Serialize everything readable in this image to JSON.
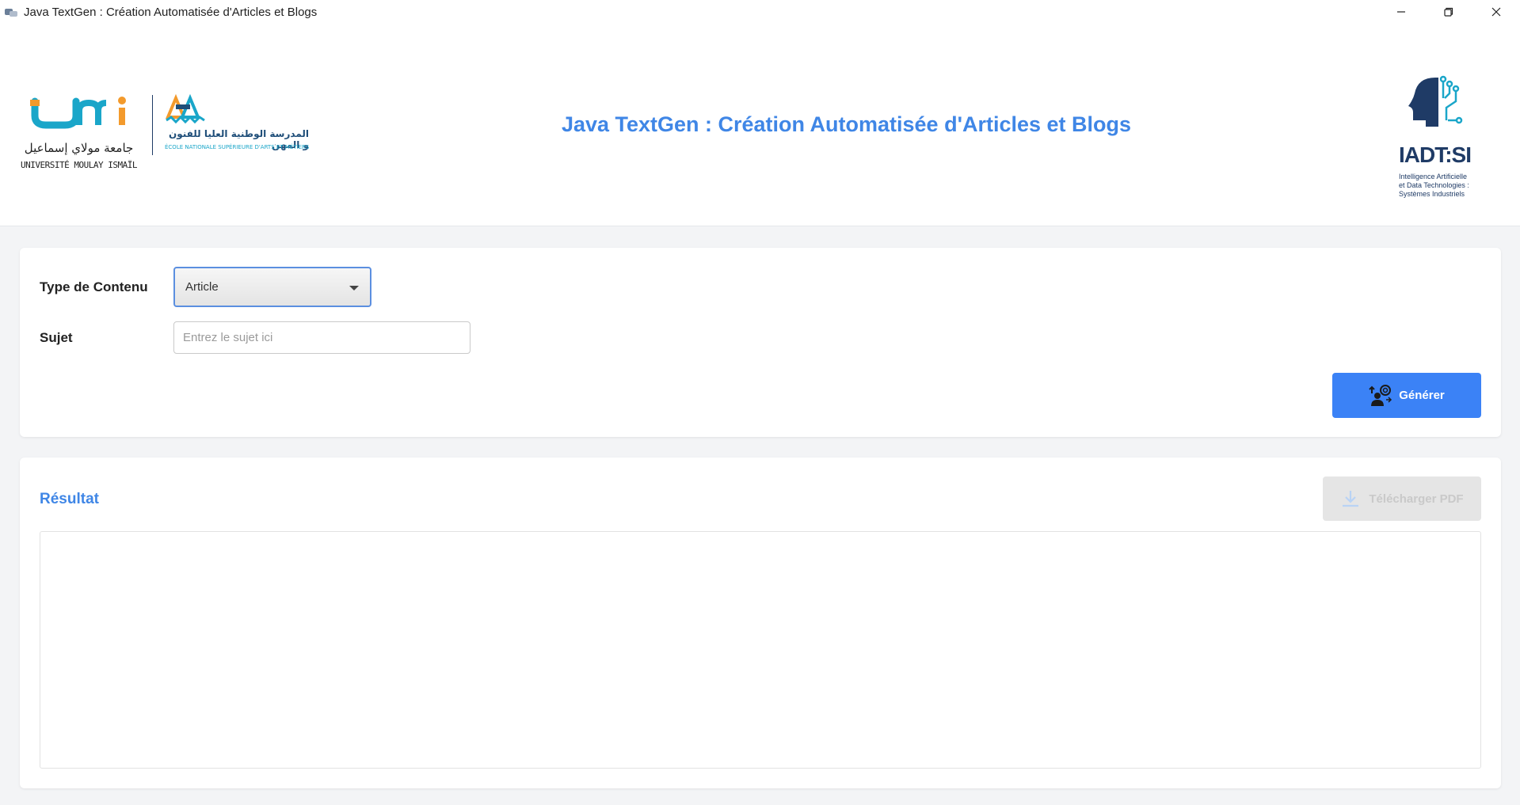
{
  "window": {
    "title": "Java TextGen : Création Automatisée d'Articles et Blogs"
  },
  "header": {
    "title": "Java TextGen : Création Automatisée d'Articles et Blogs",
    "logos": {
      "umi": {
        "arabic": "جامعة مولاي إسماعيل",
        "latin": "UNIVERSITÉ MOULAY ISMAÏL"
      },
      "ensam": {
        "arabic": "المدرسة الوطنية العليا للفنون و المهن",
        "latin": "ÉCOLE NATIONALE SUPÉRIEURE D'ARTS ET MÉTIERS"
      },
      "iadt": {
        "name": "IADT:SI",
        "line1": "Intelligence Artificielle",
        "line2": "et Data Technologies :",
        "line3": "Systèmes Industriels"
      }
    }
  },
  "form": {
    "type_label": "Type de Contenu",
    "type_selected": "Article",
    "subject_label": "Sujet",
    "subject_placeholder": "Entrez le sujet ici",
    "subject_value": "",
    "generate_label": "Générer"
  },
  "result": {
    "title": "Résultat",
    "download_label": "Télécharger PDF",
    "content": ""
  },
  "colors": {
    "accent": "#3b82f6",
    "title": "#3f86e6",
    "umi_orange": "#f39a2c",
    "umi_blue": "#1aa6c9"
  },
  "icons": {
    "generate": "ai-person-icon",
    "download": "download-icon",
    "dropdown": "caret-down-icon"
  }
}
